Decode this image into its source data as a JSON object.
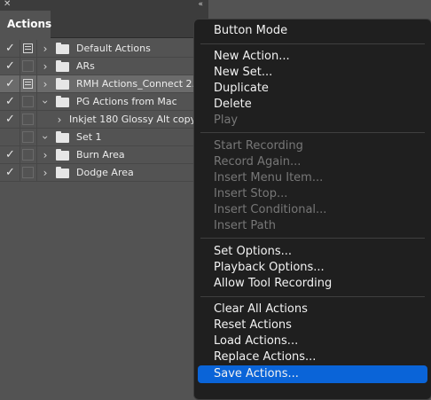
{
  "panel": {
    "tab_label": "Actions",
    "close_glyph": "✕",
    "collapse_glyph": "«",
    "rows": [
      {
        "label": "Default Actions",
        "checked": true,
        "dialog": true,
        "expanded": false,
        "kind": "set"
      },
      {
        "label": "ARs",
        "checked": true,
        "dialog": false,
        "expanded": false,
        "kind": "set"
      },
      {
        "label": "RMH Actions_Connect 2...",
        "checked": true,
        "dialog": true,
        "expanded": false,
        "kind": "set",
        "selected": true
      },
      {
        "label": "PG Actions from Mac",
        "checked": true,
        "dialog": false,
        "expanded": true,
        "kind": "set"
      },
      {
        "label": "Inkjet 180 Glossy Alt copy",
        "checked": true,
        "dialog": false,
        "expanded": false,
        "kind": "action"
      },
      {
        "label": "Set 1",
        "checked": false,
        "dialog": false,
        "expanded": true,
        "kind": "set"
      },
      {
        "label": "Burn Area",
        "checked": true,
        "dialog": false,
        "expanded": false,
        "kind": "set"
      },
      {
        "label": "Dodge Area",
        "checked": true,
        "dialog": false,
        "expanded": false,
        "kind": "set"
      }
    ]
  },
  "menu": {
    "button_mode": "Button Mode",
    "new_action": "New Action...",
    "new_set": "New Set...",
    "duplicate": "Duplicate",
    "delete": "Delete",
    "play": "Play",
    "start_recording": "Start Recording",
    "record_again": "Record Again...",
    "insert_menu_item": "Insert Menu Item...",
    "insert_stop": "Insert Stop...",
    "insert_conditional": "Insert Conditional...",
    "insert_path": "Insert Path",
    "set_options": "Set Options...",
    "playback_options": "Playback Options...",
    "allow_tool_recording": "Allow Tool Recording",
    "clear_all_actions": "Clear All Actions",
    "reset_actions": "Reset Actions",
    "load_actions": "Load Actions...",
    "replace_actions": "Replace Actions...",
    "save_actions": "Save Actions..."
  },
  "colors": {
    "panel_bg": "#535353",
    "menu_bg": "#1f1f1f",
    "highlight": "#0a64d8",
    "disabled_text": "#777777"
  }
}
